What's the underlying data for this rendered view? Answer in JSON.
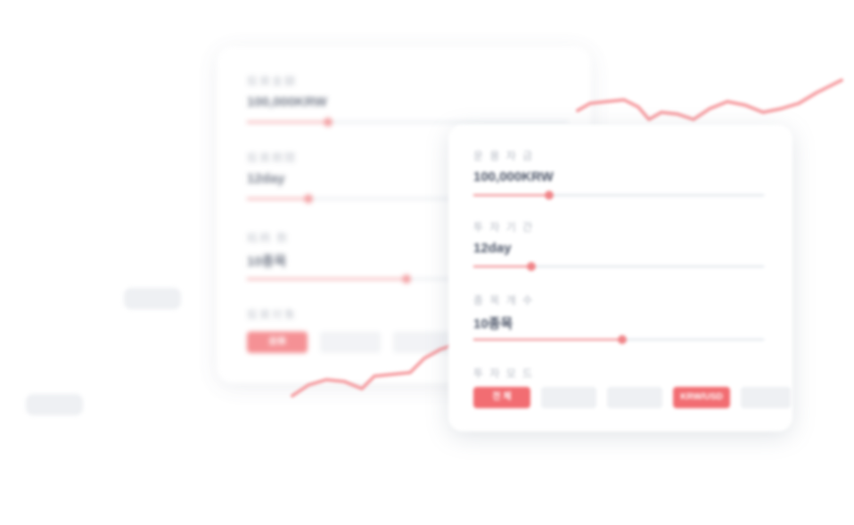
{
  "colors": {
    "accent": "#f26d72",
    "track": "#dde3ea",
    "chip_idle": "#eef0f3",
    "text": "#4a5366",
    "muted": "#b3b8c2"
  },
  "back_card": {
    "fields": [
      {
        "label": "投資金額",
        "value": "100,000KRW",
        "progress": 0.28
      },
      {
        "label": "投資期間",
        "value": "12day",
        "progress": 0.2
      },
      {
        "label": "銘柄 数",
        "value": "10종목",
        "progress": 0.5
      }
    ],
    "chips_label": "投資対象",
    "chips": [
      {
        "label": "全体",
        "active": true
      },
      {
        "label": "",
        "active": false
      },
      {
        "label": "",
        "active": false
      },
      {
        "label": "",
        "active": true
      }
    ]
  },
  "front_card": {
    "fields": [
      {
        "label": "운 용 자 금",
        "value": "100,000KRW",
        "progress": 0.26
      },
      {
        "label": "투 자 기 간",
        "value": "12day",
        "progress": 0.2
      },
      {
        "label": "종 목  개 수",
        "value": "10종목",
        "progress": 0.51
      }
    ],
    "chips_label": "투 자 모 드",
    "chips": [
      {
        "label": "전 체",
        "active": true
      },
      {
        "label": "",
        "active": false
      },
      {
        "label": "",
        "active": false
      },
      {
        "label": "KRW/USD",
        "active": true
      },
      {
        "label": "",
        "active": false
      }
    ]
  }
}
